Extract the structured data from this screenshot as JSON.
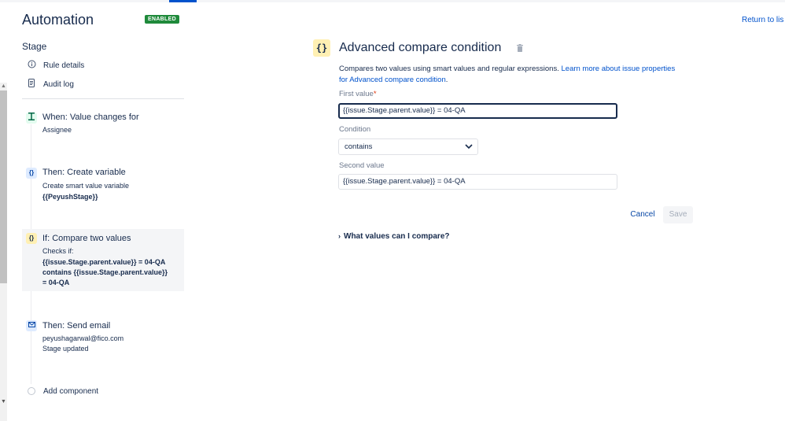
{
  "header": {
    "title": "Automation",
    "badge": "ENABLED",
    "return_link": "Return to lis"
  },
  "sidebar": {
    "stage_heading": "Stage",
    "nav": [
      {
        "label": "Rule details",
        "icon": "info-icon"
      },
      {
        "label": "Audit log",
        "icon": "document-icon"
      }
    ],
    "components": [
      {
        "kind": "trigger",
        "title": "When: Value changes for",
        "lines": [
          "Assignee"
        ],
        "icon": "trigger-icon"
      },
      {
        "kind": "action",
        "title": "Then: Create variable",
        "lines": [
          "Create smart value variable"
        ],
        "bold_lines": [
          "{{PeyushStage}}"
        ],
        "icon": "braces-icon"
      },
      {
        "kind": "condition",
        "title": "If: Compare two values",
        "lines": [
          "Checks if:"
        ],
        "bold_lines": [
          "{{issue.Stage.parent.value}} = 04-QA",
          "contains {{issue.Stage.parent.value}}",
          "= 04-QA"
        ],
        "icon": "braces-icon",
        "selected": true
      },
      {
        "kind": "action",
        "title": "Then: Send email",
        "lines": [
          "peyushagarwal@fico.com",
          "Stage updated"
        ],
        "icon": "mail-icon"
      }
    ],
    "add_component": "Add component"
  },
  "panel": {
    "icon_glyph": "{}",
    "title": "Advanced compare condition",
    "description": "Compares two values using smart values and regular expressions.",
    "learn_more_link_line1": "Learn more about issue properties",
    "learn_more_link_line2": "for Advanced compare condition",
    "first_value_label": "First value",
    "required_mark": "*",
    "first_value": "{{issue.Stage.parent.value}} = 04-QA",
    "condition_label": "Condition",
    "condition_value": "contains",
    "second_value_label": "Second value",
    "second_value": "{{issue.Stage.parent.value}} = 04-QA",
    "cancel_label": "Cancel",
    "save_label": "Save",
    "expander_label": "What values can I compare?"
  },
  "colors": {
    "primary_link": "#0052cc",
    "badge_green": "#1f8a3b",
    "condition_yellow": "#fff0b3",
    "action_blue": "#deebff",
    "trigger_green": "#e3fcef"
  }
}
